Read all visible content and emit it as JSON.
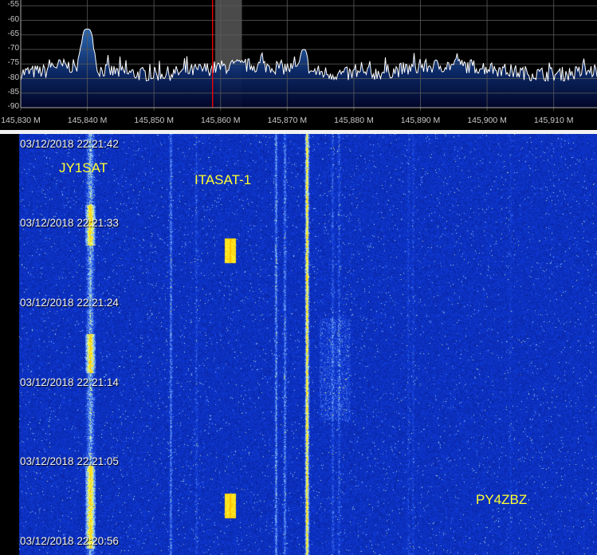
{
  "spectrum": {
    "y_axis_labels": [
      "-55",
      "-60",
      "-65",
      "-70",
      "-75",
      "-80",
      "-85",
      "-90"
    ],
    "y_range_db": [
      -90,
      -53
    ],
    "x_axis_labels": [
      "145,830 M",
      "145,840 M",
      "145,850 M",
      "145,860 M",
      "145,870 M",
      "145,880 M",
      "145,890 M",
      "145,900 M",
      "145,910 M"
    ],
    "x_range_mhz": [
      145.83,
      145.9165
    ],
    "tuned_frequency_mhz": 145.8588,
    "filter_band_mhz": [
      145.8592,
      145.8632
    ],
    "noise_floor_db": -77,
    "peaks": [
      {
        "freq_mhz": 145.84,
        "level_db": -63
      },
      {
        "freq_mhz": 145.8725,
        "level_db": -70
      }
    ],
    "colors": {
      "trace": "#ffffff",
      "fill_top": "#2f6db8",
      "fill_bottom": "#02062a",
      "grid": "#5a5a5a",
      "marker": "#ff0000",
      "filter": "#4a4a4a"
    }
  },
  "waterfall": {
    "timestamps": [
      "03/12/2018 22:21:42",
      "03/12/2018 22:21:33",
      "03/12/2018 22:21:24",
      "03/12/2018 22:21:14",
      "03/12/2018 22:21:05",
      "03/12/2018 22:20:56"
    ],
    "signal_labels": [
      "JY1SAT",
      "ITASAT-1",
      "PY4ZBZ"
    ],
    "colors": {
      "background": "#0a1a8c",
      "label": "#ffff30",
      "hot": "#ffe020"
    }
  }
}
